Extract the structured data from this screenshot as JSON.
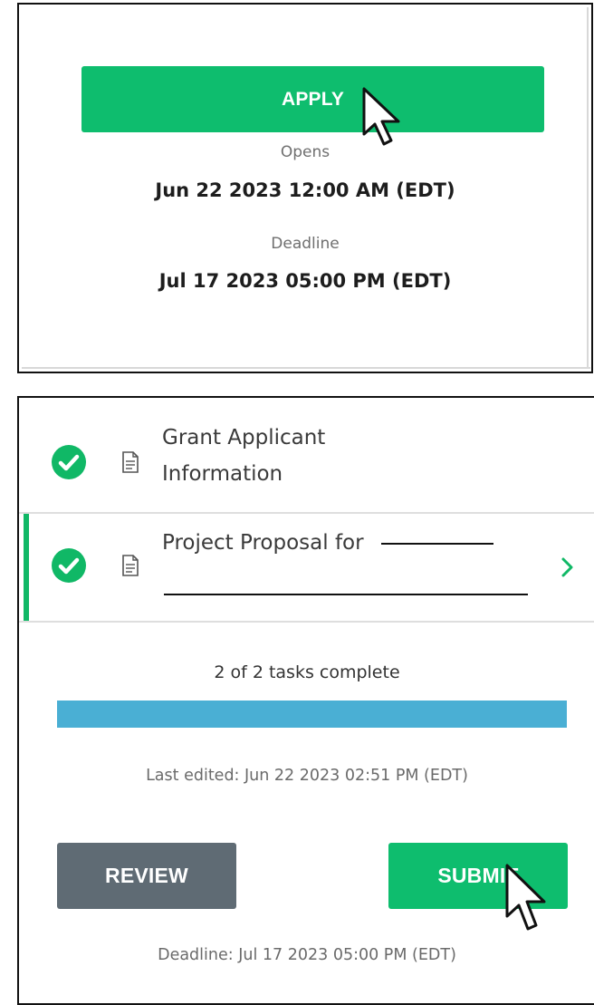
{
  "apply_panel": {
    "apply_label": "APPLY",
    "opens_label": "Opens",
    "opens_value": "Jun 22 2023 12:00 AM (EDT)",
    "deadline_label": "Deadline",
    "deadline_value": "Jul 17 2023 05:00 PM (EDT)"
  },
  "tasks_panel": {
    "tasks": [
      {
        "line1": "Grant Applicant",
        "line2": "Information",
        "status": "complete"
      },
      {
        "line1": "Project Proposal for",
        "status": "complete",
        "selected": true
      }
    ],
    "progress_text": "2 of 2 tasks complete",
    "progress_fraction": 1.0,
    "last_edited": "Last edited: Jun 22 2023 02:51 PM (EDT)",
    "review_label": "REVIEW",
    "submit_label": "SUBMIT",
    "deadline_text": "Deadline: Jul 17 2023 05:00 PM (EDT)"
  },
  "colors": {
    "primary_green": "#0ebd6e",
    "progress_blue": "#4aafd4",
    "review_gray": "#5f6b74"
  },
  "icons": [
    "check-circle-icon",
    "document-icon",
    "chevron-right-icon",
    "pointer-cursor-icon"
  ]
}
